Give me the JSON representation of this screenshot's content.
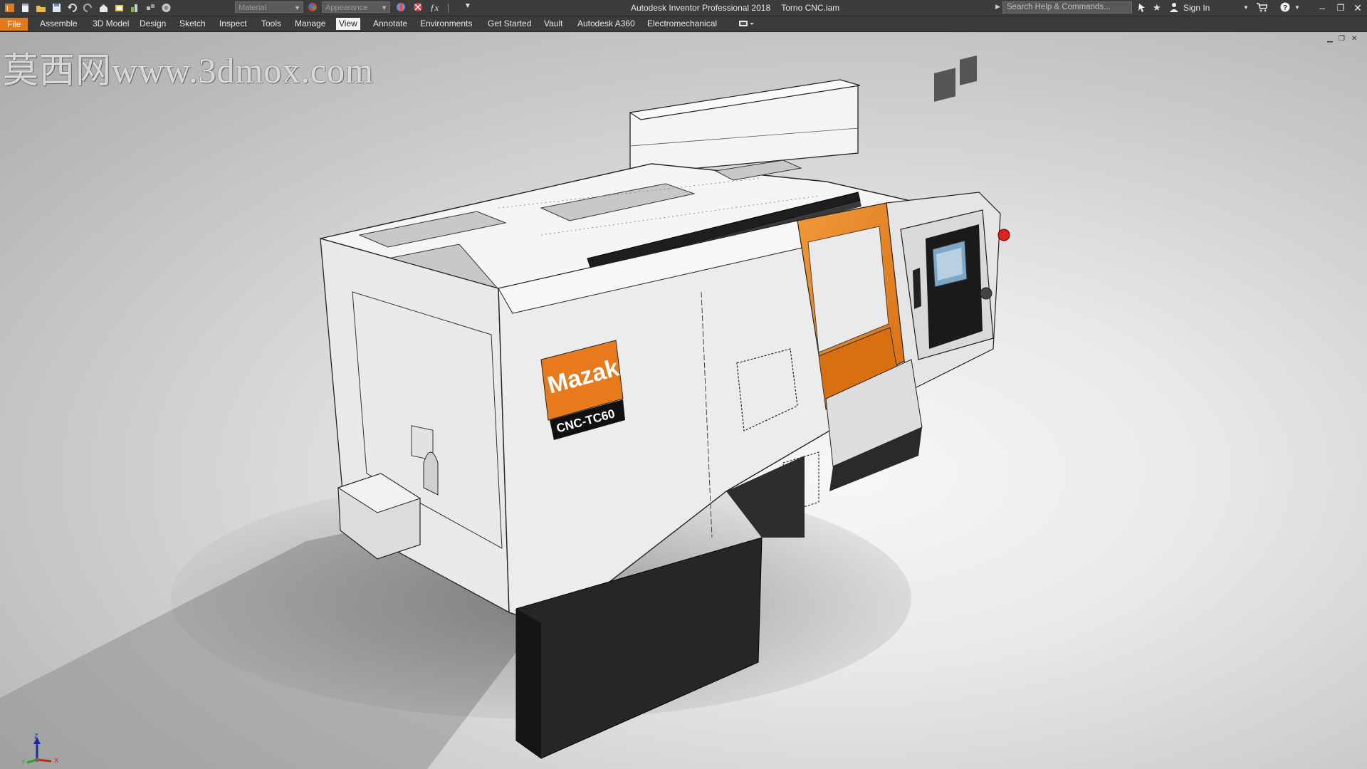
{
  "title": {
    "app": "Autodesk Inventor Professional 2018",
    "document": "Torno CNC.iam"
  },
  "quick_access": {
    "material_value": "Material",
    "appearance_value": "Appearance"
  },
  "search": {
    "placeholder": "Search Help & Commands..."
  },
  "account": {
    "sign_in_label": "Sign In"
  },
  "ribbon": {
    "tabs": [
      {
        "label": "File"
      },
      {
        "label": "Assemble"
      },
      {
        "label": "3D Model"
      },
      {
        "label": "Design"
      },
      {
        "label": "Sketch"
      },
      {
        "label": "Inspect"
      },
      {
        "label": "Tools"
      },
      {
        "label": "Manage"
      },
      {
        "label": "View"
      },
      {
        "label": "Annotate"
      },
      {
        "label": "Environments"
      },
      {
        "label": "Get Started"
      },
      {
        "label": "Vault"
      },
      {
        "label": "Autodesk A360"
      },
      {
        "label": "Electromechanical"
      }
    ],
    "active_tab": "View"
  },
  "model": {
    "brand_label": "Mazak",
    "model_label": "CNC-TC60"
  },
  "axis_triad": {
    "z": "Z",
    "y": "Y",
    "x": "X"
  },
  "watermark": "莫西网www.3dmox.com",
  "icons": {
    "save": "save-icon",
    "open": "open-icon",
    "undo": "undo-icon",
    "redo": "redo-icon",
    "search": "search-icon",
    "help": "help-icon",
    "cart": "cart-icon",
    "user": "user-icon"
  },
  "colors": {
    "accent": "#e07b1c",
    "titlebar": "#3c3c3c",
    "machine_orange": "#e8821e",
    "machine_body": "#eeeeee",
    "machine_base": "#262626"
  }
}
